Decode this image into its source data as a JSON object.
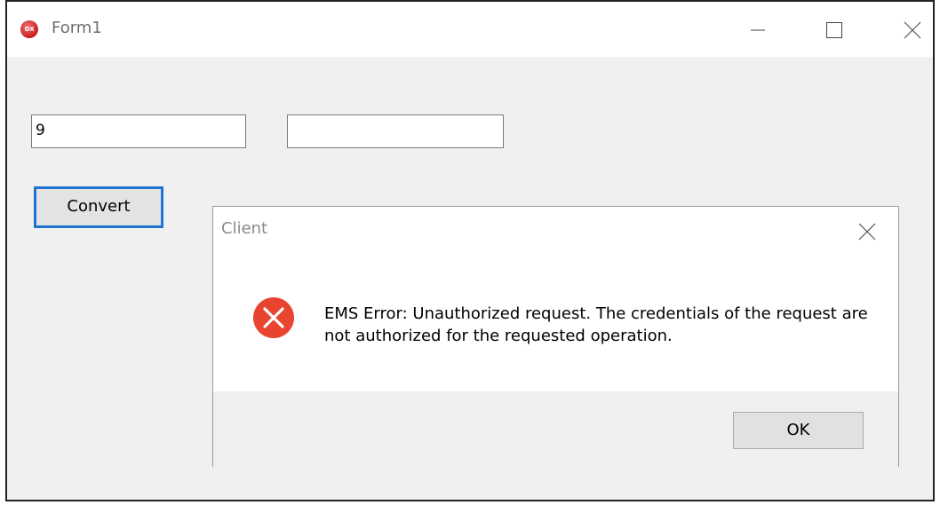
{
  "window": {
    "title": "Form1",
    "icon": "dx-logo-icon"
  },
  "form": {
    "input1_value": "9",
    "input2_value": "",
    "convert_label": "Convert"
  },
  "dialog": {
    "title": "Client",
    "icon": "error-icon",
    "message": "EMS Error: Unauthorized request. The credentials of the request are not authorized for the requested operation.",
    "ok_label": "OK"
  },
  "colors": {
    "error_red": "#e8442f",
    "focus_blue": "#1e74d0"
  }
}
